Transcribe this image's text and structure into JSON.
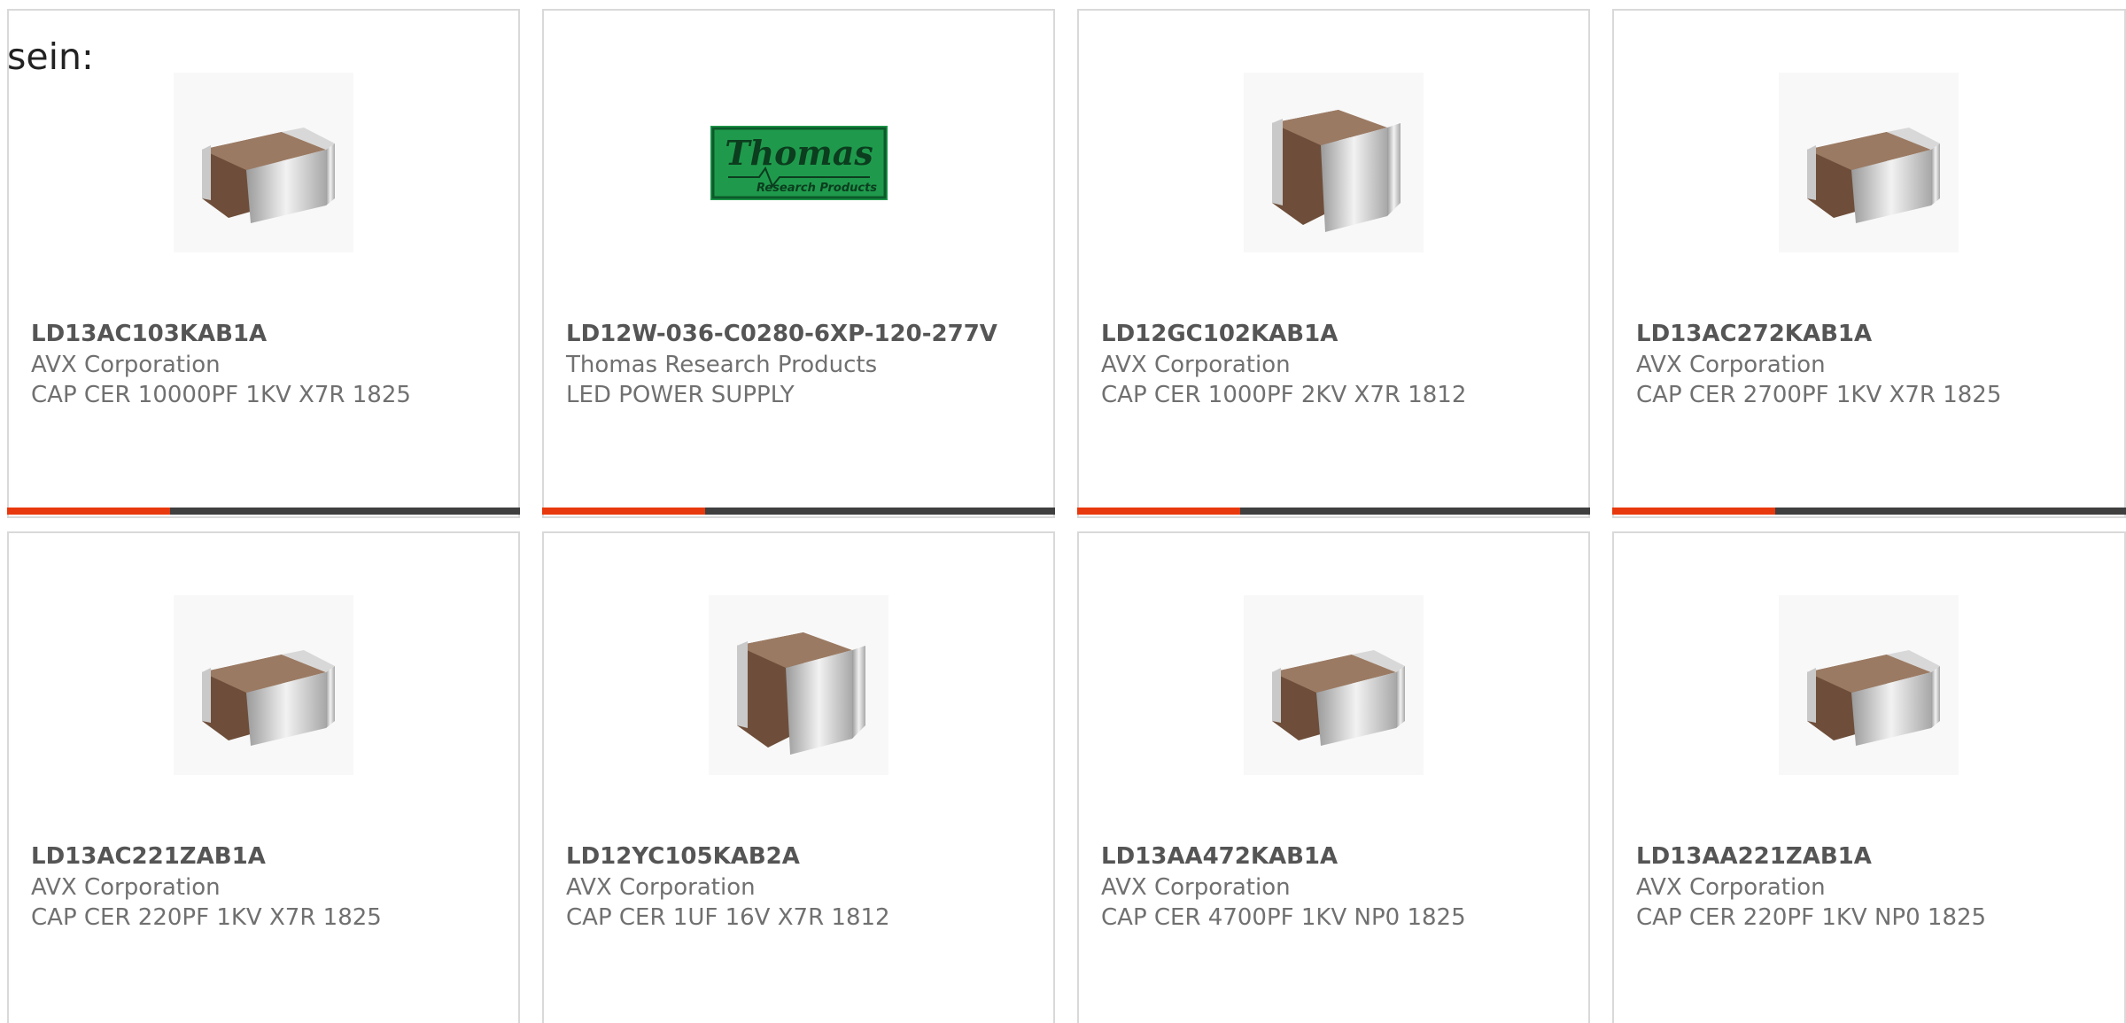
{
  "intro_text": "sein:",
  "colors": {
    "accent": "#e8380d",
    "bar": "#3f3f3f",
    "part_number": "#555555",
    "secondary_text": "#707070",
    "thomas_green": "#1f9a4c"
  },
  "products": [
    {
      "part": "LD13AC103KAB1A",
      "manufacturer": "AVX Corporation",
      "description": "CAP CER 10000PF 1KV X7R 1825",
      "image": "capacitor-icon"
    },
    {
      "part": "LD12W-036-C0280-6XP-120-277V",
      "manufacturer": "Thomas Research Products",
      "description": "LED POWER SUPPLY",
      "image": "thomas-logo",
      "logo": {
        "line1": "Thomas",
        "line2": "Research Products"
      }
    },
    {
      "part": "LD12GC102KAB1A",
      "manufacturer": "AVX Corporation",
      "description": "CAP CER 1000PF 2KV X7R 1812",
      "image": "capacitor-icon"
    },
    {
      "part": "LD13AC272KAB1A",
      "manufacturer": "AVX Corporation",
      "description": "CAP CER 2700PF 1KV X7R 1825",
      "image": "capacitor-icon"
    },
    {
      "part": "LD13AC221ZAB1A",
      "manufacturer": "AVX Corporation",
      "description": "CAP CER 220PF 1KV X7R 1825",
      "image": "capacitor-icon"
    },
    {
      "part": "LD12YC105KAB2A",
      "manufacturer": "AVX Corporation",
      "description": "CAP CER 1UF 16V X7R 1812",
      "image": "capacitor-icon"
    },
    {
      "part": "LD13AA472KAB1A",
      "manufacturer": "AVX Corporation",
      "description": "CAP CER 4700PF 1KV NP0 1825",
      "image": "capacitor-icon"
    },
    {
      "part": "LD13AA221ZAB1A",
      "manufacturer": "AVX Corporation",
      "description": "CAP CER 220PF 1KV NP0 1825",
      "image": "capacitor-icon"
    }
  ]
}
